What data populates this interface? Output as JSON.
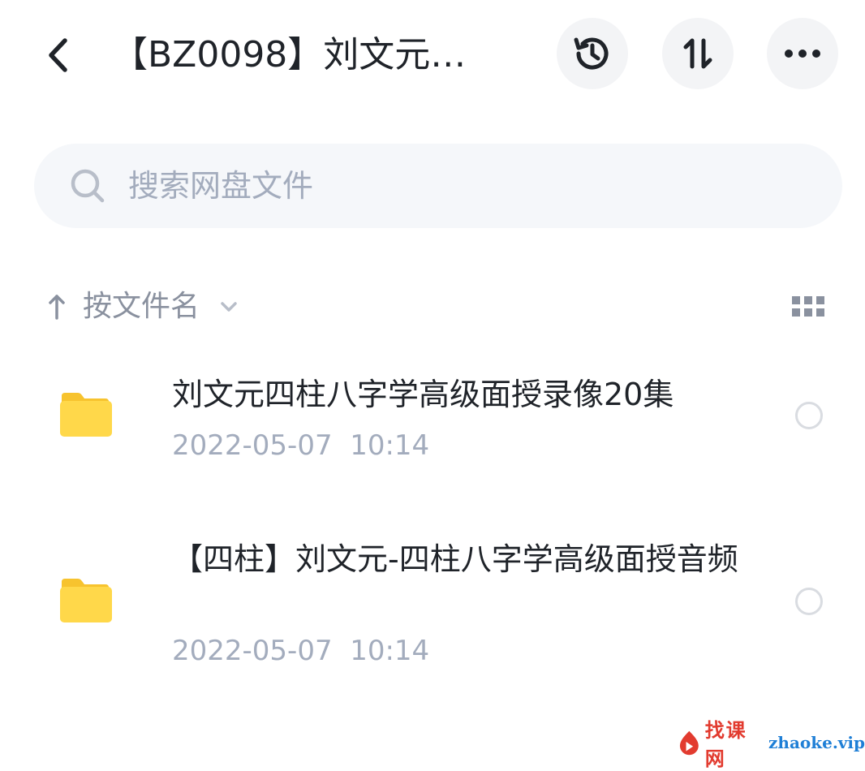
{
  "header": {
    "title": "【BZ0098】刘文元…",
    "back_icon": "chevron-left-icon",
    "history_icon": "history-icon",
    "sort_icon": "sort-toggle-icon",
    "more_icon": "more-dots-icon"
  },
  "search": {
    "placeholder": "搜索网盘文件",
    "value": ""
  },
  "sort_bar": {
    "label": "按文件名",
    "direction_icon": "arrow-up-icon",
    "dropdown_icon": "chevron-down-icon",
    "view_icon": "grid-view-icon"
  },
  "files": [
    {
      "name": "刘文元四柱八字学高级面授录像20集",
      "date": "2022-05-07",
      "time": "10:14",
      "meta": "2022-05-07  10:14",
      "icon": "folder-icon"
    },
    {
      "name": "【四柱】刘文元-四柱八字学高级面授音频",
      "date": "2022-05-07",
      "time": "10:14",
      "meta": "2022-05-07  10:14",
      "icon": "folder-icon"
    }
  ],
  "watermark": {
    "cn": "找课网",
    "en": "zhaoke.vip"
  },
  "colors": {
    "accent_folder": "#ffd84a",
    "folder_tab": "#f7c32e",
    "secondary_text": "#a3acbd",
    "button_bg": "#f3f4f6",
    "search_bg": "#f5f7fa"
  }
}
